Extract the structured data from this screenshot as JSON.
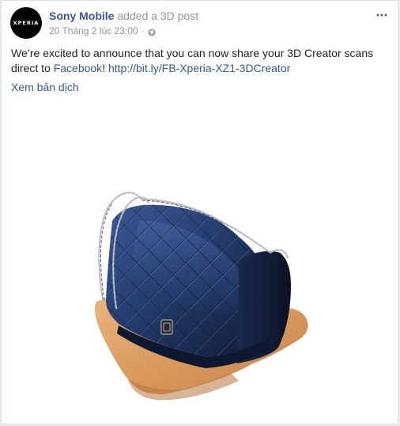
{
  "post": {
    "author": "Sony Mobile",
    "action": "added a 3D post",
    "avatar_text": "XPERIA",
    "timestamp": "20 Tháng 2 lúc 23:00",
    "separator": "·",
    "privacy_icon": "globe-icon",
    "more_icon": "more-options-icon",
    "text_part1": "We’re excited to announce that you can now share your 3D Creator scans direct to ",
    "text_link1": "Facebook",
    "text_part2": "! ",
    "text_link2": "http://bit.ly/FB-Xperia-XZ1-3DCreator",
    "translate_label": "Xem bản dịch"
  },
  "media": {
    "type": "3D model",
    "subject": "quilted blue leather handbag with chain strap on a wooden base"
  },
  "colors": {
    "link": "#365899",
    "meta": "#90949c",
    "text": "#1d2129"
  }
}
